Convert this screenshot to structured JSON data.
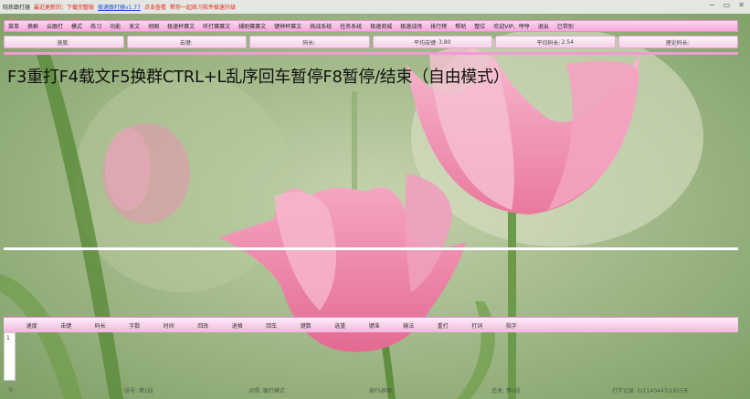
{
  "titlebar": {
    "title": "晓炼跟打器",
    "notice": "最近更新的：下载完整版",
    "link": "极速跟打器v1.77",
    "notice2": "点击查看",
    "notice3": "帮你一起练习软件极速升级"
  },
  "window_controls": {
    "minimize": "−",
    "restore": "▭",
    "close": "✕"
  },
  "menu": [
    "菜单",
    "换群",
    "云跟打",
    "模式",
    "练习",
    "功能",
    "发文",
    "地图",
    "极速杯赛文",
    "听打赛赛文",
    "辅助赛赛文",
    "键神杯赛文",
    "挑战系统",
    "任务系统",
    "极速商城",
    "极速战场",
    "排行榜",
    "帮助",
    "整位",
    "欢迎VIP、哼哼",
    "退出",
    "已带别"
  ],
  "stats": [
    {
      "label": "速度:",
      "value": ""
    },
    {
      "label": "击键:",
      "value": ""
    },
    {
      "label": "码长:",
      "value": ""
    },
    {
      "label": "平均击键:",
      "value": "3.80"
    },
    {
      "label": "平均码长:",
      "value": "2.54"
    },
    {
      "label": "理论码长:",
      "value": ""
    }
  ],
  "reading_text": "F3重打F4载文F5换群CTRL+L乱序回车暂停F8暂停/结束（自由模式）",
  "table_columns": [
    "速度",
    "击键",
    "码长",
    "字数",
    "时间",
    "回改",
    "退格",
    "回车",
    "键数",
    "选重",
    "键准",
    "输法",
    "重打",
    "打词",
    "指字"
  ],
  "rows": [
    {
      "index": "1"
    }
  ],
  "status": {
    "left": "0",
    "count": "段号: 第1段",
    "mode": "对照: 跟打模式",
    "hint": "按F5换群",
    "seg": "追发: 第0段",
    "record": "打字记录: 0/1140447/1955天"
  },
  "colors": {
    "menu_pink": "#f5a9dd",
    "accent_pink": "#f19bd6",
    "text": "#111111"
  }
}
